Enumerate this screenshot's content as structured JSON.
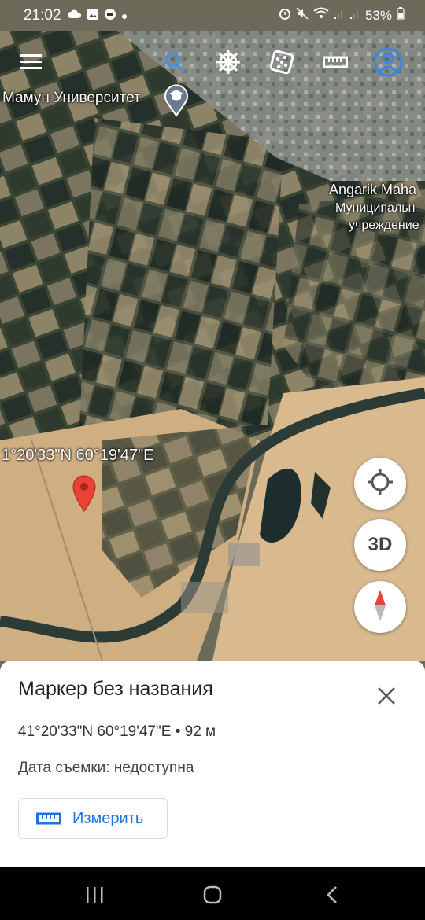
{
  "status_bar": {
    "time": "21:02",
    "battery": "53%",
    "left_icons": [
      "cloud-icon",
      "image-icon",
      "app-icon",
      "dot-icon"
    ],
    "right_icons": [
      "alarm-icon",
      "mute-icon",
      "wifi-icon",
      "signal-icon",
      "signal-icon",
      "battery-icon"
    ]
  },
  "toolbar": {
    "icons": [
      "menu-icon",
      "search-icon",
      "voyager-wheel-icon",
      "dice-icon",
      "ruler-icon",
      "account-icon"
    ]
  },
  "map": {
    "labels": {
      "university": "Мамун Университет",
      "angarik_line1": "Angarik Maha",
      "angarik_line2": "Муниципальн",
      "angarik_line3": "учреждение"
    },
    "coordinate_overlay": "1°20'33\"N 60°19'47\"E"
  },
  "controls": {
    "three_d_label": "3D"
  },
  "sheet": {
    "title": "Маркер без названия",
    "coords": "41°20'33\"N 60°19'47\"E • 92 м",
    "date": "Дата съемки: недоступна",
    "measure_label": "Измерить"
  },
  "colors": {
    "accent": "#1a73e8",
    "marker": "#ea4335",
    "sand": "#d9b98e",
    "field_dark": "#2e3a2c"
  }
}
